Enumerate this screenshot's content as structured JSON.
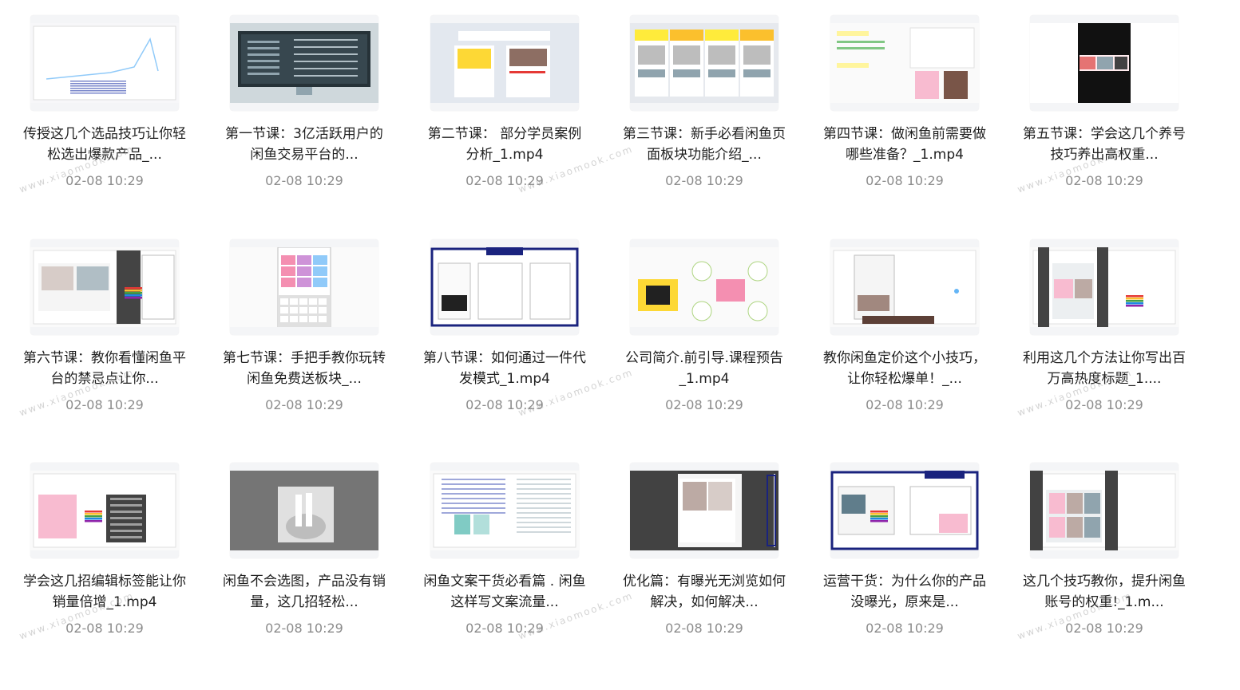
{
  "items": [
    {
      "title": "传授这几个选品技巧让你轻松选出爆款产品_...",
      "time": "02-08 10:29",
      "thumb": "analytics"
    },
    {
      "title": "第一节课：3亿活跃用户的闲鱼交易平台的...",
      "time": "02-08 10:29",
      "thumb": "monitor"
    },
    {
      "title": "第二节课： 部分学员案例分析_1.mp4",
      "time": "02-08 10:29",
      "thumb": "cases"
    },
    {
      "title": "第三节课：新手必看闲鱼页面板块功能介绍_...",
      "time": "02-08 10:29",
      "thumb": "panels"
    },
    {
      "title": "第四节课：做闲鱼前需要做哪些准备？_1.mp4",
      "time": "02-08 10:29",
      "thumb": "prep"
    },
    {
      "title": "第五节课：学会这几个养号技巧养出高权重...",
      "time": "02-08 10:29",
      "thumb": "phone-dark"
    },
    {
      "title": "第六节课：教你看懂闲鱼平台的禁忌点让你...",
      "time": "02-08 10:29",
      "thumb": "taboo"
    },
    {
      "title": "第七节课：手把手教你玩转闲鱼免费送板块_...",
      "time": "02-08 10:29",
      "thumb": "phone-light"
    },
    {
      "title": "第八节课：如何通过一件代发模式_1.mp4",
      "time": "02-08 10:29",
      "thumb": "dropship"
    },
    {
      "title": "公司简介.前引导.课程预告_1.mp4",
      "time": "02-08 10:29",
      "thumb": "intro"
    },
    {
      "title": "教你闲鱼定价这个小技巧，让你轻松爆单！_...",
      "time": "02-08 10:29",
      "thumb": "pricing"
    },
    {
      "title": "利用这几个方法让你写出百万高热度标题_1....",
      "time": "02-08 10:29",
      "thumb": "titles"
    },
    {
      "title": "学会这几招编辑标签能让你销量倍增_1.mp4",
      "time": "02-08 10:29",
      "thumb": "tags"
    },
    {
      "title": "闲鱼不会选图，产品没有销量，这几招轻松...",
      "time": "02-08 10:29",
      "thumb": "photo"
    },
    {
      "title": "闲鱼文案干货必看篇 . 闲鱼这样写文案流量...",
      "time": "02-08 10:29",
      "thumb": "copy"
    },
    {
      "title": "优化篇：有曝光无浏览如何解决，如何解决...",
      "time": "02-08 10:29",
      "thumb": "optimize"
    },
    {
      "title": "运营干货：为什么你的产品没曝光，原来是...",
      "time": "02-08 10:29",
      "thumb": "exposure"
    },
    {
      "title": "这几个技巧教你，提升闲鱼账号的权重!_1.m...",
      "time": "02-08 10:29",
      "thumb": "weight"
    }
  ],
  "watermark": "www.xiaomook.com",
  "colors": {
    "title": "#1f1f1f",
    "time": "#8c8c8c",
    "thumb_bg": "#f4f5f7"
  }
}
